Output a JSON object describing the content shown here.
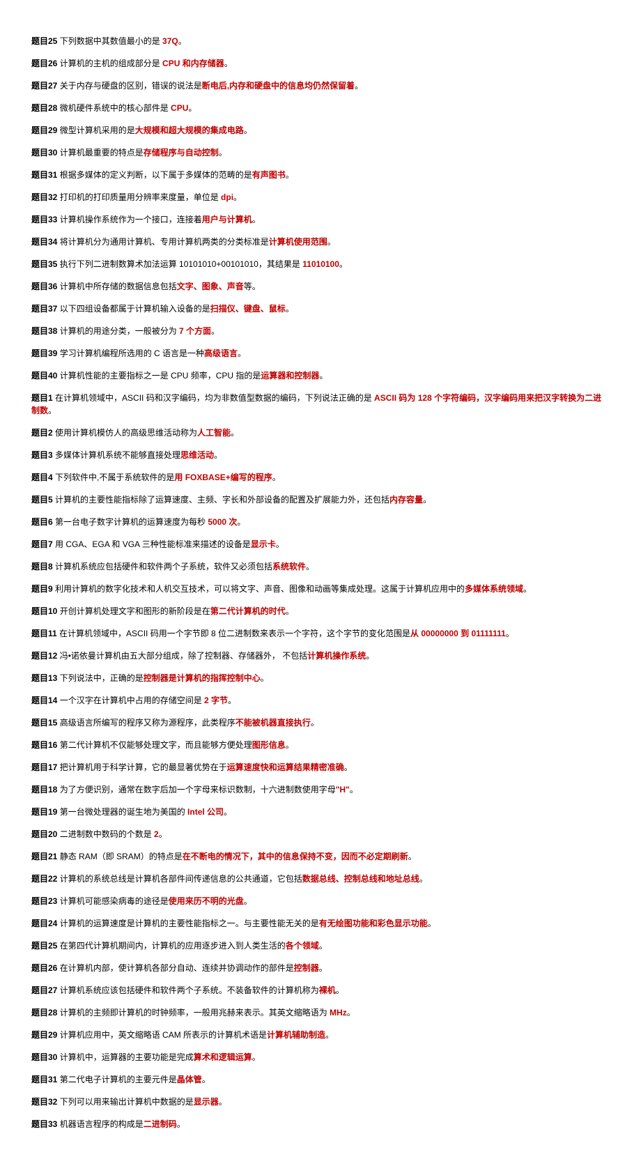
{
  "items": [
    {
      "label": "题目25",
      "stem": " 下列数据中其数值最小的是 ",
      "ans": "37Q",
      "tail": "。"
    },
    {
      "label": "题目26",
      "stem": " 计算机的主机的组成部分是 ",
      "ans": "CPU 和内存储器",
      "tail": "。"
    },
    {
      "label": "题目27",
      "stem": " 关于内存与硬盘的区别，错误的说法是",
      "ans": "断电后,内存和硬盘中的信息均仍然保留着",
      "tail": "。"
    },
    {
      "label": "题目28",
      "stem": " 微机硬件系统中的核心部件是 ",
      "ans": "CPU",
      "tail": "。"
    },
    {
      "label": "题目29",
      "stem": " 微型计算机采用的是",
      "ans": "大规模和超大规模的集成电路",
      "tail": "。"
    },
    {
      "label": "题目30",
      "stem": " 计算机最重要的特点是",
      "ans": "存储程序与自动控制",
      "tail": "。"
    },
    {
      "label": "题目31",
      "stem": " 根据多媒体的定义判断，以下属于多媒体的范畴的是",
      "ans": "有声图书",
      "tail": "。"
    },
    {
      "label": "题目32",
      "stem": " 打印机的打印质量用分辨率来度量，单位是 ",
      "ans": "dpi",
      "tail": "。"
    },
    {
      "label": "题目33",
      "stem": " 计算机操作系统作为一个接口，连接着",
      "ans": "用户与计算机",
      "tail": "。"
    },
    {
      "label": "题目34",
      "stem": " 将计算机分为通用计算机、专用计算机两类的分类标准是",
      "ans": "计算机使用范围",
      "tail": "。"
    },
    {
      "label": "题目35",
      "stem": " 执行下列二进制数算术加法运算 10101010+00101010，其结果是 ",
      "ans": "11010100",
      "tail": "。"
    },
    {
      "label": "题目36",
      "stem": " 计算机中所存储的数据信息包括",
      "ans": "文字、图象、声音",
      "tail": "等。"
    },
    {
      "label": "题目37",
      "stem": " 以下四组设备都属于计算机输入设备的是",
      "ans": "扫描仪、键盘、鼠标",
      "tail": "。"
    },
    {
      "label": "题目38",
      "stem": " 计算机的用途分类，一般被分为 ",
      "ans": "7 个方面",
      "tail": "。"
    },
    {
      "label": "题目39",
      "stem": " 学习计算机编程所选用的 C 语言是一种",
      "ans": "高级语言",
      "tail": "。"
    },
    {
      "label": "题目40",
      "stem": " 计算机性能的主要指标之一是 CPU 频率，CPU 指的是",
      "ans": "运算器和控制器",
      "tail": "。"
    },
    {
      "label": "题目1",
      "stem": " 在计算机领域中，ASCII 码和汉字编码，均为非数值型数据的编码，下列说法正确的是 ",
      "ans": "ASCII 码为 128 个字符编码，汉字编码用来把汉字转换为二进制数",
      "tail": "。"
    },
    {
      "label": "题目2",
      "stem": " 使用计算机模仿人的高级思维活动称为",
      "ans": "人工智能",
      "tail": "。"
    },
    {
      "label": "题目3",
      "stem": " 多媒体计算机系统不能够直接处理",
      "ans": "思维活动",
      "tail": "。"
    },
    {
      "label": "题目4",
      "stem": " 下列软件中,不属于系统软件的是",
      "ans": "用 FOXBASE+编写的程序",
      "tail": "。"
    },
    {
      "label": "题目5",
      "stem": " 计算机的主要性能指标除了运算速度、主频、字长和外部设备的配置及扩展能力外，还包括",
      "ans": "内存容量",
      "tail": "。"
    },
    {
      "label": "题目6",
      "stem": " 第一台电子数字计算机的运算速度为每秒 ",
      "ans": "5000 次",
      "tail": "。"
    },
    {
      "label": "题目7",
      "stem": " 用 CGA、EGA 和 VGA 三种性能标准来描述的设备是",
      "ans": "显示卡",
      "tail": "。"
    },
    {
      "label": "题目8",
      "stem": " 计算机系统应包括硬件和软件两个子系统，软件又必须包括",
      "ans": "系统软件",
      "tail": "。"
    },
    {
      "label": "题目9",
      "stem": " 利用计算机的数字化技术和人机交互技术，可以将文字、声音、图像和动画等集成处理。这属于计算机应用中的",
      "ans": "多媒体系统领域",
      "tail": "。"
    },
    {
      "label": "题目10",
      "stem": " 开创计算机处理文字和图形的新阶段是在",
      "ans": "第二代计算机的时代",
      "tail": "。"
    },
    {
      "label": "题目11",
      "stem": " 在计算机领域中，ASCII 码用一个字节即 8 位二进制数来表示一个字符，这个字节的变化范围是",
      "ans": "从 00000000 到 01111111",
      "tail": "。"
    },
    {
      "label": "题目12",
      "stem": " 冯•诺依曼计算机由五大部分组成，除了控制器、存储器外， 不包括",
      "ans": "计算机操作系统",
      "tail": "。"
    },
    {
      "label": "题目13",
      "stem": " 下列说法中，正确的是",
      "ans": "控制器是计算机的指挥控制中心",
      "tail": "。"
    },
    {
      "label": "题目14",
      "stem": " 一个汉字在计算机中占用的存储空间是 ",
      "ans": "2 字节",
      "tail": "。"
    },
    {
      "label": "题目15",
      "stem": " 高级语言所编写的程序又称为源程序，此类程序",
      "ans": "不能被机器直接执行",
      "tail": "。"
    },
    {
      "label": "题目16",
      "stem": " 第二代计算机不仅能够处理文字，而且能够方便处理",
      "ans": "图形信息",
      "tail": "。"
    },
    {
      "label": "题目17",
      "stem": " 把计算机用于科学计算，它的最显著优势在于",
      "ans": "运算速度快和运算结果精密准确",
      "tail": "。"
    },
    {
      "label": "题目18",
      "stem": " 为了方便识别，通常在数字后加一个字母来标识数制，十六进制数使用字母",
      "ans": "\"H\"",
      "tail": "。"
    },
    {
      "label": "题目19",
      "stem": " 第一台微处理器的诞生地为美国的 ",
      "ans": "Intel 公司",
      "tail": "。"
    },
    {
      "label": "题目20",
      "stem": " 二进制数中数码的个数是 ",
      "ans": "2",
      "tail": "。"
    },
    {
      "label": "题目21",
      "stem": " 静态 RAM（即 SRAM）的特点是",
      "ans": "在不断电的情况下，其中的信息保持不变，因而不必定期刷新",
      "tail": "。"
    },
    {
      "label": "题目22",
      "stem": " 计算机的系统总线是计算机各部件间传递信息的公共通道，它包括",
      "ans": "数据总线、控制总线和地址总线",
      "tail": "。"
    },
    {
      "label": "题目23",
      "stem": " 计算机可能感染病毒的途径是",
      "ans": "使用来历不明的光盘",
      "tail": "。"
    },
    {
      "label": "题目24",
      "stem": " 计算机的运算速度是计算机的主要性能指标之一。与主要性能无关的是",
      "ans": "有无绘图功能和彩色显示功能",
      "tail": "。"
    },
    {
      "label": "题目25",
      "stem": " 在第四代计算机期间内，计算机的应用逐步进入到人类生活的",
      "ans": "各个领域",
      "tail": "。"
    },
    {
      "label": "题目26",
      "stem": " 在计算机内部，使计算机各部分自动、连续并协调动作的部件是",
      "ans": "控制器",
      "tail": "。"
    },
    {
      "label": "题目27",
      "stem": " 计算机系统应该包括硬件和软件两个子系统。不装备软件的计算机称为",
      "ans": "裸机",
      "tail": "。"
    },
    {
      "label": "题目28",
      "stem": " 计算机的主频即计算机的时钟频率，一般用兆赫来表示。其英文缩略语为 ",
      "ans": "MHz",
      "tail": "。"
    },
    {
      "label": "题目29",
      "stem": " 计算机应用中，英文缩略语 CAM 所表示的计算机术语是",
      "ans": "计算机辅助制造",
      "tail": "。"
    },
    {
      "label": "题目30",
      "stem": " 计算机中，运算器的主要功能是完成",
      "ans": "算术和逻辑运算",
      "tail": "。"
    },
    {
      "label": "题目31",
      "stem": " 第二代电子计算机的主要元件是",
      "ans": "晶体管",
      "tail": "。"
    },
    {
      "label": "题目32",
      "stem": " 下列可以用来输出计算机中数据的是",
      "ans": "显示器",
      "tail": "。"
    },
    {
      "label": "题目33",
      "stem": " 机器语言程序的构成是",
      "ans": "二进制码",
      "tail": "。"
    }
  ]
}
